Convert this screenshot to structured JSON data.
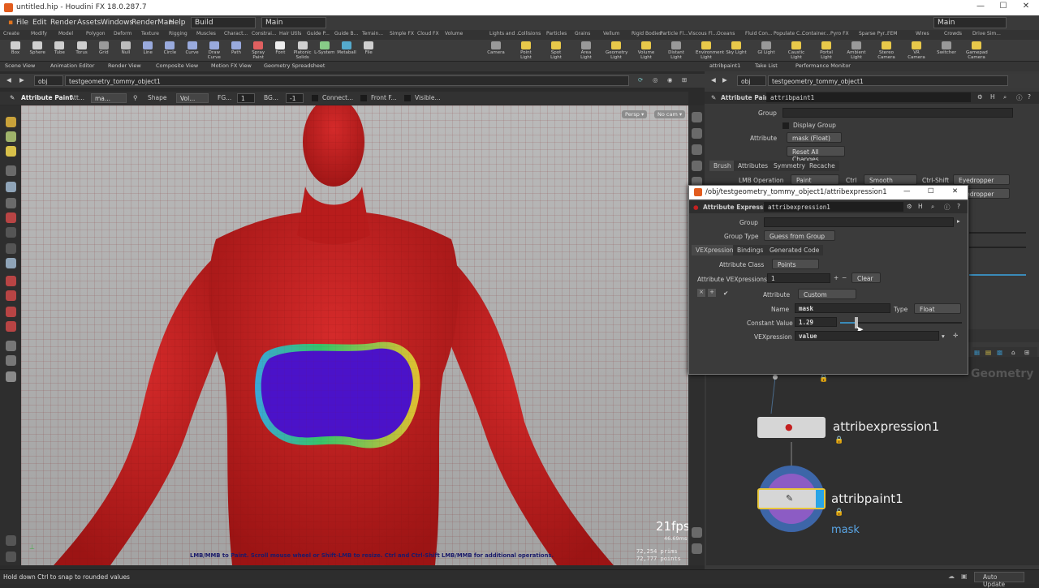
{
  "window": {
    "title": "untitled.hip - Houdini FX 18.0.287.7",
    "minimize": "—",
    "maximize": "☐",
    "close": "✕"
  },
  "menubar": {
    "items": [
      "File",
      "Edit",
      "Render",
      "Assets",
      "Windows",
      "RenderMan",
      "Help"
    ],
    "desktop_left": "Build",
    "desktop_right": "Main",
    "desktop_center": "Main"
  },
  "shelf_tabs_left": [
    "Create",
    "Modify",
    "Model",
    "Polygon",
    "Deform",
    "Texture",
    "Rigging",
    "Muscles",
    "Charact...",
    "Constrai...",
    "Hair Utils",
    "Guide P...",
    "Guide B...",
    "Terrain...",
    "Simple FX",
    "Cloud FX",
    "Volume"
  ],
  "shelf_tabs_right": [
    "Lights and ...",
    "Collisions",
    "Particles",
    "Grains",
    "Vellum",
    "Rigid Bodies",
    "Particle Fl...",
    "Viscous Fl...",
    "Oceans",
    "Fluid Con...",
    "Populate C...",
    "Container...",
    "Pyro FX",
    "Sparse Pyr...",
    "FEM",
    "Wires",
    "Crowds",
    "Drive Sim..."
  ],
  "shelf_tools_left": [
    "Box",
    "Sphere",
    "Tube",
    "Torus",
    "Grid",
    "Null",
    "Line",
    "Circle",
    "Curve",
    "Draw Curve",
    "Path",
    "Spray Paint",
    "Font",
    "Platonic Solids",
    "L-System",
    "Metaball",
    "File"
  ],
  "shelf_tools_right": [
    "Camera",
    "Point Light",
    "Spot Light",
    "Area Light",
    "Geometry Light",
    "Volume Light",
    "Distant Light",
    "Environment Light",
    "Sky Light",
    "GI Light",
    "Caustic Light",
    "Portal Light",
    "Ambient Light",
    "Stereo Camera",
    "VR Camera",
    "Switcher",
    "Gamepad Camera"
  ],
  "pane_tabs_left": [
    "Scene View",
    "Animation Editor",
    "Render View",
    "Composite View",
    "Motion FX View",
    "Geometry Spreadsheet"
  ],
  "pane_tabs_right": [
    "attribpaint1",
    "Take List",
    "Performance Monitor"
  ],
  "path_left": {
    "obj": "obj",
    "node": "testgeometry_tommy_object1"
  },
  "path_right": {
    "obj": "obj",
    "node": "testgeometry_tommy_object1"
  },
  "op_toolbar": {
    "title": "Attribute Paint",
    "attr_label": "Att...",
    "attr_value": "ma...",
    "shape_label": "Shape",
    "shape_value": "Vol...",
    "fg_label": "FG...",
    "fg_value": "1",
    "bg_label": "BG...",
    "bg_value": "-1",
    "connect": "Connect...",
    "front": "Front F...",
    "visible": "Visible..."
  },
  "viewport": {
    "persp": "Persp ▾",
    "cam": "No cam ▾",
    "fps": "21fps",
    "ms": "46.69ms",
    "prims": "72,254  prims",
    "points": "72,777  points",
    "hint": "LMB/MMB to Paint.  Scroll mouse wheel or Shift-LMB to resize.  Ctrl and Ctrl-Shift LMB/MMB for additional operations.",
    "body_color": "#c42020",
    "mask_color": "#4b12c9"
  },
  "status": {
    "text": "Hold down Ctrl to snap to rounded values",
    "auto_update": "Auto Update"
  },
  "param_panel": {
    "node_type": "Attribute Paint",
    "node_name": "attribpaint1",
    "group_label": "Group",
    "display_group": "Display Group",
    "attribute_label": "Attribute",
    "attribute_value": "mask (Float)",
    "reset": "Reset All Changes",
    "tabs": [
      "Brush",
      "Attributes",
      "Symmetry",
      "Recache"
    ],
    "lmb_label": "LMB Operation",
    "lmb_value": "Paint",
    "ctrl_label": "Ctrl",
    "ctrl_value": "Smooth",
    "ctrlshift_label": "Ctrl-Shift",
    "ctrlshift_value": "Eyedropper",
    "mmb_value": "Eyedropper"
  },
  "dialog": {
    "title": "/obj/testgeometry_tommy_object1/attribexpression1",
    "node_type": "Attribute Expression",
    "node_name": "attribexpression1",
    "group_label": "Group",
    "group_type_label": "Group Type",
    "group_type_value": "Guess from Group",
    "tabs": [
      "VEXpressions",
      "Bindings",
      "Generated Code"
    ],
    "attr_class_label": "Attribute Class",
    "attr_class_value": "Points",
    "attr_vex_label": "Attribute VEXpressions",
    "attr_vex_value": "1",
    "clear": "Clear",
    "attribute_label": "Attribute",
    "attribute_value": "Custom",
    "name_label": "Name",
    "name_value": "mask",
    "type_label": "Type",
    "type_value": "Float",
    "const_label": "Constant Value",
    "const_value": "1.29",
    "const_fraction": 0.13,
    "vex_label": "VEXpression",
    "vex_value": "value"
  },
  "network": {
    "context": "Geometry",
    "node1": "attribexpression1",
    "node2": "attribpaint1",
    "node2_sub": "mask"
  }
}
